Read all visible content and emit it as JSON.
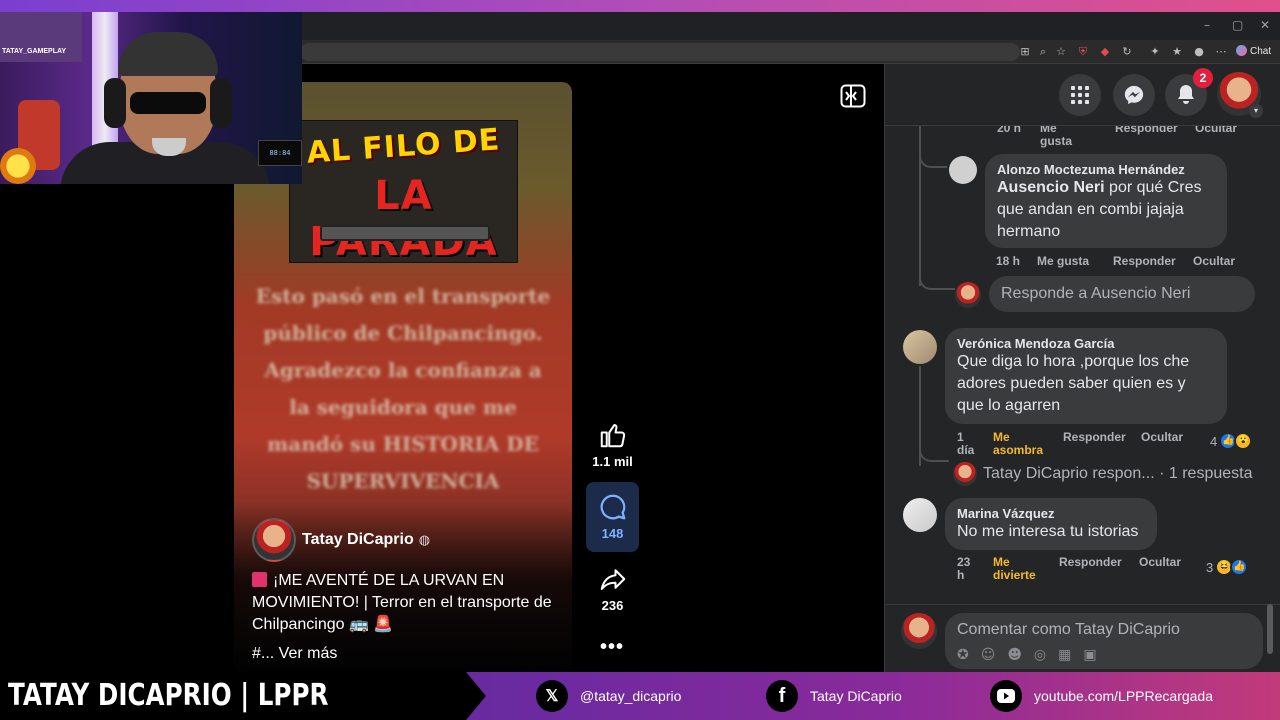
{
  "browser": {
    "chat_label": "Chat",
    "window_controls": [
      "–",
      "▢",
      "✕"
    ]
  },
  "notifications": {
    "badge_count": "2"
  },
  "reel": {
    "poster_line1": "AL FILO DE",
    "poster_line2": "LA PARADA",
    "overlay_text": "Esto pasó en el transporte público de Chilpancingo. Agradezco la confianza a la seguidora que me mandó su HISTORIA DE SUPERVIVENCIA",
    "author": "Tatay DiCaprio",
    "caption": "¡ME AVENTÉ DE LA URVAN EN MOVIMIENTO! | Terror en el transporte de Chilpancingo 🚌 🚨",
    "see_more": "#... Ver más",
    "likes": "1.1 mil",
    "comments": "148",
    "shares": "236"
  },
  "comments": {
    "top_meta": {
      "time": "20 h",
      "like": "Me gusta",
      "reply": "Responder",
      "hide": "Ocultar"
    },
    "items": [
      {
        "name": "Alonzo Moctezuma Hernández",
        "mention": "Ausencio Neri",
        "text": " por qué Cres que andan en combi jajaja hermano",
        "time": "18 h",
        "like": "Me gusta",
        "reply": "Responder",
        "hide": "Ocultar"
      },
      {
        "name": "Verónica Mendoza García",
        "text": "Que diga lo hora ,porque los che adores pueden saber quien es y que lo agarren",
        "time": "1 día",
        "like": "Me asombra",
        "reply": "Responder",
        "hide": "Ocultar",
        "reaction_count": "4",
        "thread_author": "Tatay DiCaprio respon...",
        "thread_count": "· 1 respuesta"
      },
      {
        "name": "Marina Vázquez",
        "text": "No me interesa tu istorias",
        "time": "23 h",
        "like": "Me divierte",
        "reply": "Responder",
        "hide": "Ocultar",
        "reaction_count": "3"
      }
    ],
    "reply_placeholder": "Responde a Ausencio Neri",
    "compose_placeholder": "Comentar como Tatay DiCaprio"
  },
  "cam": {
    "shelf_text": "TATAY_GAMEPLAY",
    "monitor": "88:84"
  },
  "banner": {
    "title": "TATAY DICAPRIO | LPPR",
    "x_handle": "@tatay_dicaprio",
    "facebook": "Tatay DiCaprio",
    "youtube": "youtube.com/LPPRecargada"
  },
  "colors": {
    "fb_blue": "#1877f2",
    "panel_bg": "#242526",
    "bubble_bg": "#3a3b3c",
    "reaction_yellow": "#f7b928"
  }
}
